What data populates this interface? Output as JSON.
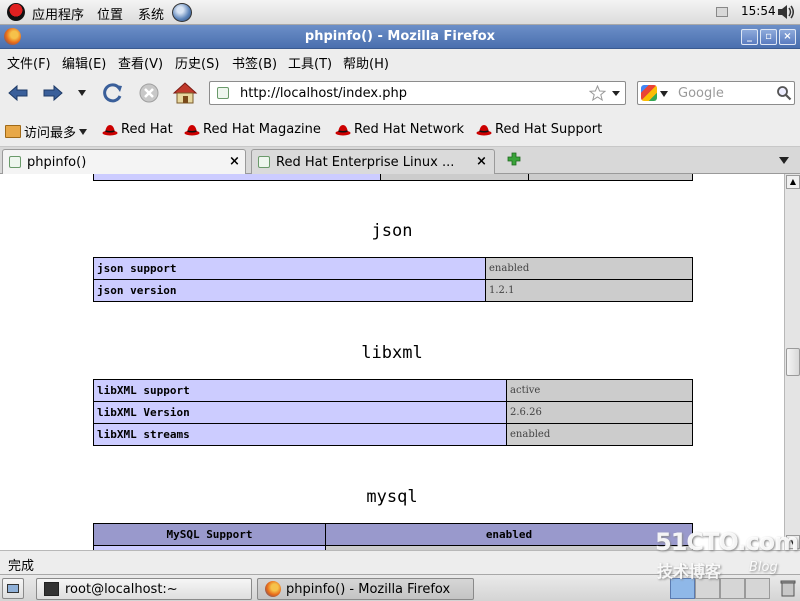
{
  "top_panel": {
    "applications": "应用程序",
    "places": "位置",
    "system": "系统",
    "clock": "15:54"
  },
  "window": {
    "title": "phpinfo() - Mozilla Firefox"
  },
  "menubar": [
    {
      "label": "文件(F)"
    },
    {
      "label": "编辑(E)"
    },
    {
      "label": "查看(V)"
    },
    {
      "label": "历史(S)"
    },
    {
      "label": "书签(B)"
    },
    {
      "label": "工具(T)"
    },
    {
      "label": "帮助(H)"
    }
  ],
  "navbar": {
    "url": "http://localhost/index.php",
    "search_placeholder": "Google"
  },
  "bookmarks": {
    "most_visited": "访问最多",
    "items": [
      "Red Hat",
      "Red Hat Magazine",
      "Red Hat Network",
      "Red Hat Support"
    ]
  },
  "tabs": [
    {
      "label": "phpinfo()"
    },
    {
      "label": "Red Hat Enterprise Linux ..."
    }
  ],
  "content": {
    "json": {
      "title": "json",
      "rows": [
        {
          "key": "json support",
          "value": "enabled"
        },
        {
          "key": "json version",
          "value": "1.2.1"
        }
      ]
    },
    "libxml": {
      "title": "libxml",
      "rows": [
        {
          "key": "libXML support",
          "value": "active"
        },
        {
          "key": "libXML Version",
          "value": "2.6.26"
        },
        {
          "key": "libXML streams",
          "value": "enabled"
        }
      ]
    },
    "mysql": {
      "title": "mysql",
      "header": [
        "MySQL Support",
        "enabled"
      ]
    }
  },
  "statusbar": {
    "text": "完成"
  },
  "taskbar": [
    {
      "label": "root@localhost:~"
    },
    {
      "label": "phpinfo() - Mozilla Firefox"
    }
  ],
  "watermark": {
    "line1": "51CTO.com",
    "line2": "技术博客",
    "line3": "Blog"
  },
  "colors": {
    "phpinfo_key_bg": "#ccccff",
    "phpinfo_value_bg": "#cccccc",
    "phpinfo_header_bg": "#9999cc",
    "titlebar_blue": "#4a6fae"
  }
}
